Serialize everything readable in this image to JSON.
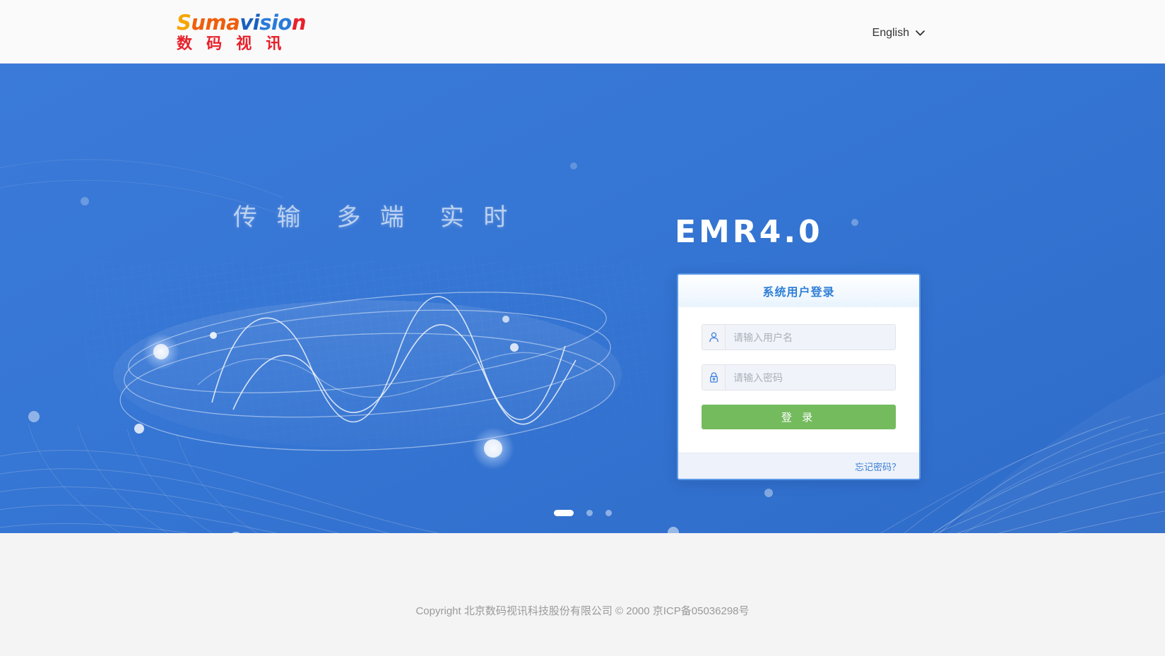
{
  "header": {
    "logo": {
      "en_parts": [
        "S",
        "uma",
        "vi",
        "sio",
        "n"
      ],
      "en_text": "Sumavision",
      "cn_text": "数 码 视 讯"
    },
    "language": {
      "label": "English",
      "icon": "chevron-down-icon"
    }
  },
  "hero": {
    "tagline_parts": [
      "传 输",
      "多 端",
      "实 时"
    ],
    "product_title": "EMR4.0",
    "background_color": "#3575d3",
    "carousel": {
      "total": 3,
      "active_index": 0
    }
  },
  "login": {
    "card_title": "系统用户登录",
    "username": {
      "icon": "user-icon",
      "placeholder": "请输入用户名",
      "value": ""
    },
    "password": {
      "icon": "lock-icon",
      "placeholder": "请输入密码",
      "value": ""
    },
    "submit_label": "登 录",
    "submit_color": "#74bb5e",
    "forgot_label": "忘记密码？",
    "link_color": "#3a7fd5",
    "border_color": "#5b9ae8"
  },
  "footer": {
    "copyright": "Copyright 北京数码视讯科技股份有限公司 © 2000 京ICP备05036298号"
  }
}
